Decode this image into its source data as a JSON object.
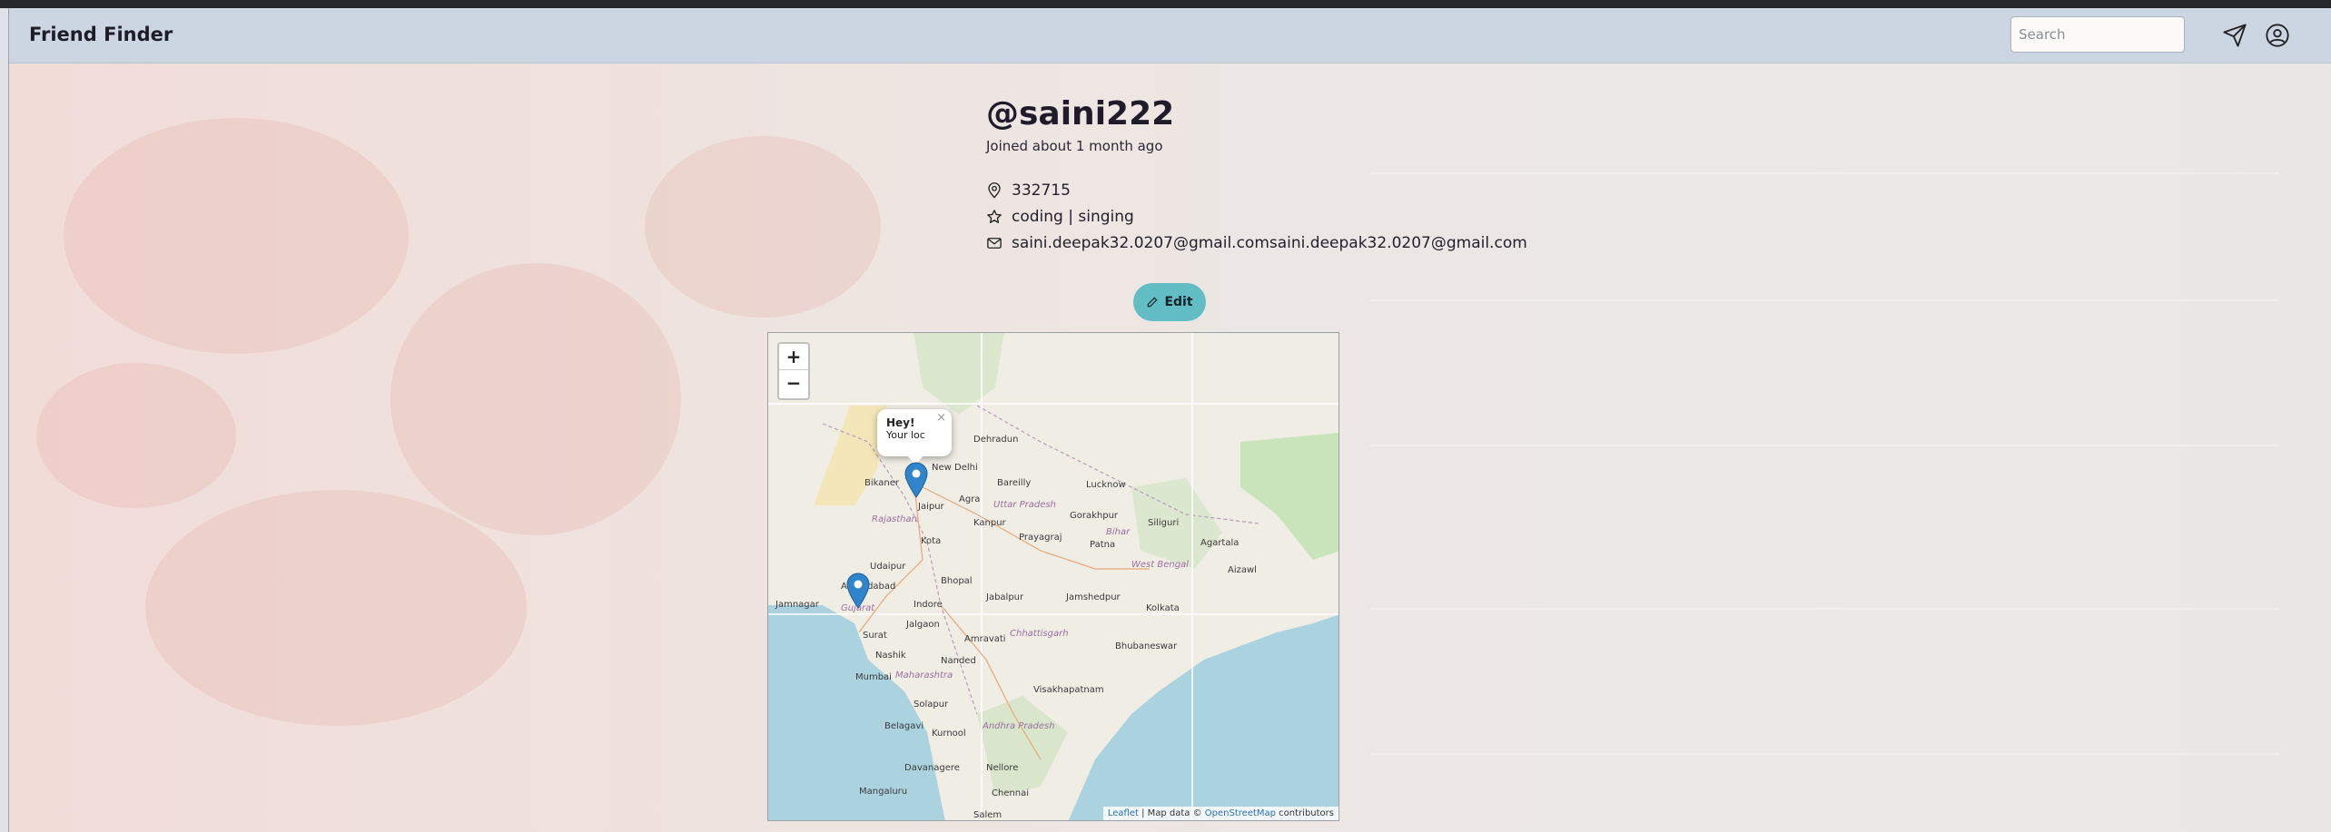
{
  "app": {
    "brand": "Friend Finder"
  },
  "navbar": {
    "search_placeholder": "Search",
    "icons": [
      "send-icon",
      "account-circle-icon"
    ]
  },
  "profile": {
    "handle": "@saini222",
    "joined": "Joined about 1 month ago",
    "pincode": "332715",
    "interests": "coding | singing",
    "email": "saini.deepak32.0207@gmail.comsaini.deepak32.0207@gmail.com"
  },
  "edit_button": {
    "label": "Edit"
  },
  "map": {
    "zoom_in": "+",
    "zoom_out": "−",
    "popup": {
      "title": "Hey!",
      "text": "Your loc",
      "close": "×"
    },
    "city_labels": [
      "Bikaner",
      "New Delhi",
      "Dehradun",
      "Bareilly",
      "Jaipur",
      "Agra",
      "Kanpur",
      "Lucknow",
      "Gorakhpur",
      "Siliguri",
      "Kota",
      "Prayagraj",
      "Patna",
      "Udaipur",
      "Bhopal",
      "Jabalpur",
      "Jamshedpur",
      "Kolkata",
      "Ahmedabad",
      "Indore",
      "Jamnagar",
      "Surat",
      "Jalgaon",
      "Amravati",
      "Nashik",
      "Nanded",
      "Bhubaneswar",
      "Mumbai",
      "Solapur",
      "Visakhapatnam",
      "Belagavi",
      "Kurnool",
      "Davanagere",
      "Nellore",
      "Mangaluru",
      "Chennai",
      "Salem",
      "Rajasthan",
      "Uttar Pradesh",
      "Bihar",
      "West Bengal",
      "Chhattisgarh",
      "Maharashtra",
      "Andhra Pradesh",
      "Gujarat",
      "Aizawl",
      "Agartala"
    ],
    "attribution": {
      "leaflet": "Leaflet",
      "middle": " | Map data © ",
      "osm": "OpenStreetMap",
      "suffix": " contributors"
    }
  }
}
